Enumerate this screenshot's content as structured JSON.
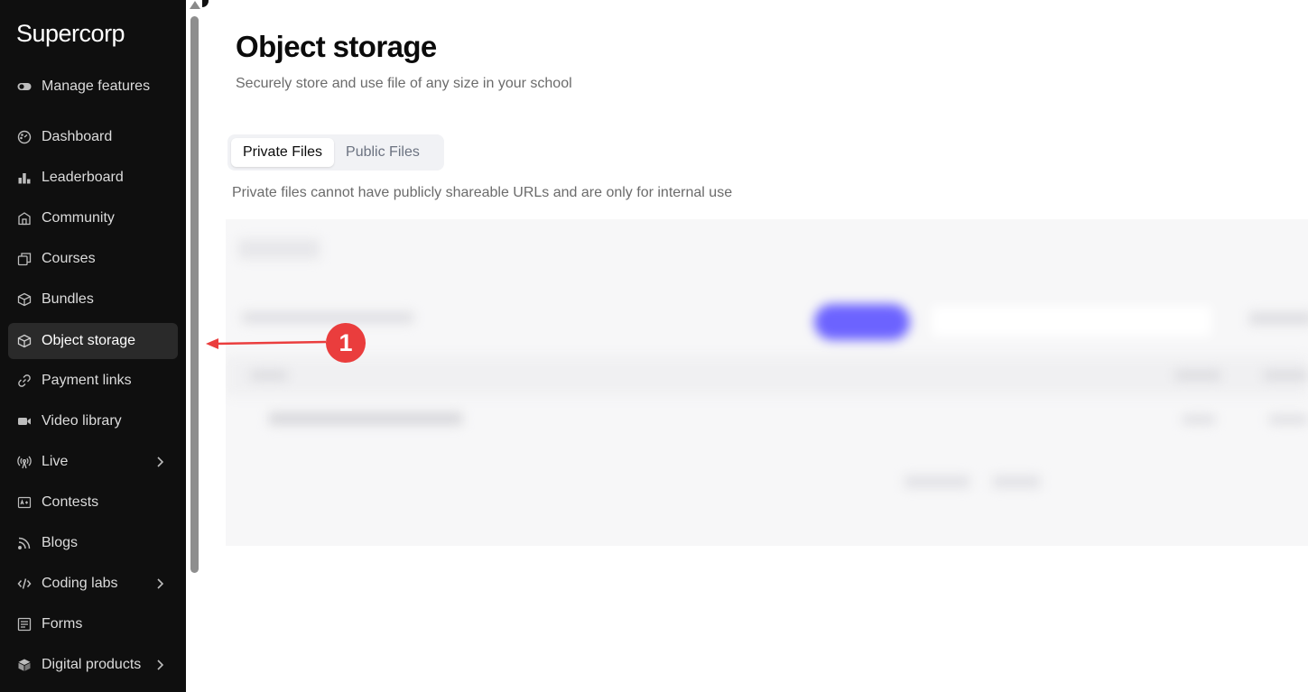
{
  "sidebar": {
    "brand": "Supercorp",
    "items": [
      {
        "label": "Manage features",
        "icon": "toggle-icon"
      },
      {
        "label": "Dashboard",
        "icon": "gauge-icon"
      },
      {
        "label": "Leaderboard",
        "icon": "bar-chart-icon"
      },
      {
        "label": "Community",
        "icon": "community-icon"
      },
      {
        "label": "Courses",
        "icon": "copy-icon"
      },
      {
        "label": "Bundles",
        "icon": "package-icon"
      },
      {
        "label": "Object storage",
        "icon": "box-icon",
        "active": true
      },
      {
        "label": "Payment links",
        "icon": "link-icon"
      },
      {
        "label": "Video library",
        "icon": "video-icon"
      },
      {
        "label": "Live",
        "icon": "broadcast-icon",
        "expandable": true
      },
      {
        "label": "Contests",
        "icon": "trophy-icon"
      },
      {
        "label": "Blogs",
        "icon": "rss-icon"
      },
      {
        "label": "Coding labs",
        "icon": "code-icon",
        "expandable": true
      },
      {
        "label": "Forms",
        "icon": "form-icon"
      },
      {
        "label": "Digital products",
        "icon": "package-icon",
        "expandable": true
      }
    ]
  },
  "main": {
    "title": "Object storage",
    "subtitle": "Securely store and use file of any size in your school",
    "tabs": [
      {
        "label": "Private Files",
        "active": true
      },
      {
        "label": "Public Files",
        "active": false
      }
    ],
    "tab_description": "Private files cannot have publicly shareable URLs and are only for internal use"
  },
  "annotation": {
    "badge": "1",
    "color": "#ea3d3d"
  },
  "colors": {
    "sidebar_bg": "#0f0f0f",
    "active_item_bg": "#2a2a2a",
    "accent_blurred_button": "#6c63ff"
  }
}
